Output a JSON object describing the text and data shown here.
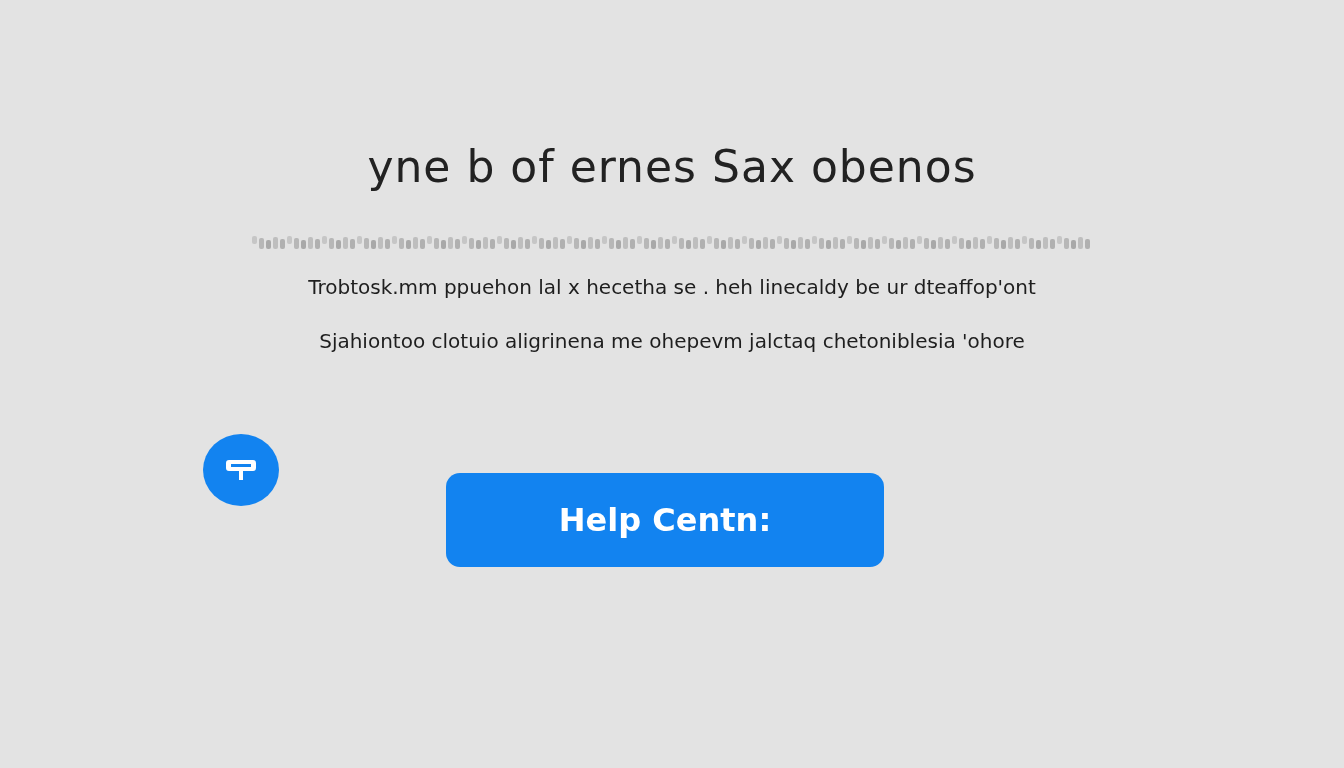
{
  "heading": "yne b of ernes Sax obenos",
  "paragraphs": [
    "Trobtosk.mm ppuehon lal x hecetha se . heh linecaldy be ur dteaffop'ont",
    "Sjahiontoo clotuio aligrinena me ohepevm jalctaq chetoniblesia 'ohore"
  ],
  "help_button": {
    "label": "Help Centn:"
  }
}
